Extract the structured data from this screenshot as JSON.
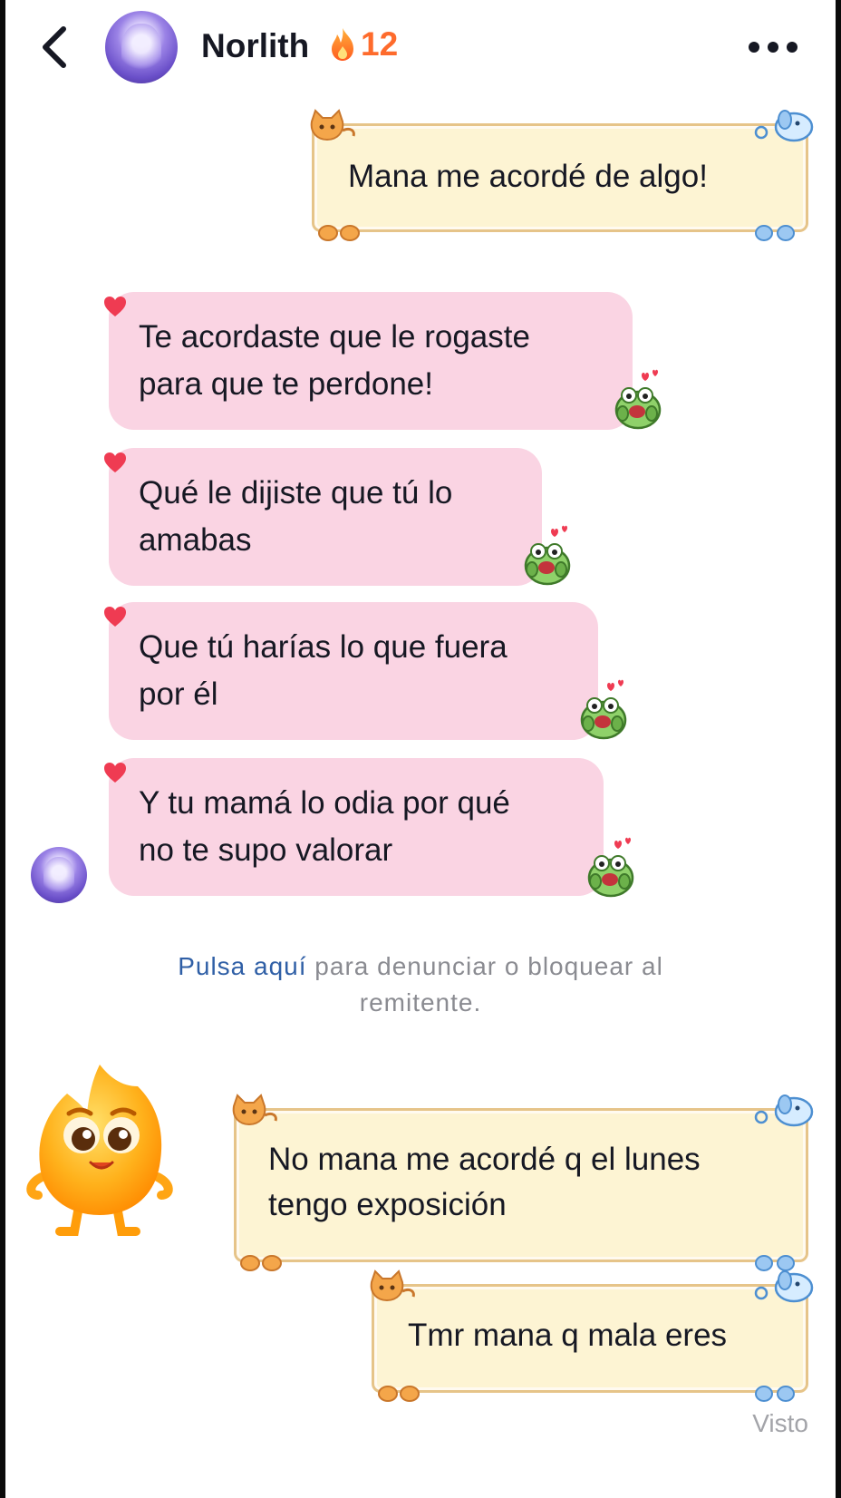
{
  "header": {
    "contact_name": "Norlith",
    "streak_count": "12",
    "icons": [
      "chevron-left-icon",
      "flame-icon",
      "more-dots-icon"
    ]
  },
  "messages": [
    {
      "side": "right",
      "style": "cream-frame",
      "text": "Mana me acordé de algo!"
    },
    {
      "side": "left",
      "style": "pink",
      "lines": [
        "Te acordaste que le rogaste",
        "para que te perdone!"
      ]
    },
    {
      "side": "left",
      "style": "pink",
      "lines": [
        "Qué le dijiste que tú lo",
        "amabas"
      ]
    },
    {
      "side": "left",
      "style": "pink",
      "lines": [
        "Que tú harías lo que fuera",
        "por él"
      ]
    },
    {
      "side": "left",
      "style": "pink",
      "lines": [
        "Y tu mamá lo odia por qué",
        "no te supo valorar"
      ]
    },
    {
      "side": "right",
      "style": "cream-frame",
      "lines": [
        "No mana me acordé q el lunes",
        "tengo exposición"
      ]
    },
    {
      "side": "right",
      "style": "cream-frame",
      "text": "Tmr mana q mala eres"
    }
  ],
  "report": {
    "link_text": "Pulsa aquí",
    "line1_rest": " para denunciar o bloquear al",
    "line2": "remitente."
  },
  "status": {
    "seen_label": "Visto"
  },
  "colors": {
    "accent_orange": "#fe6b2c",
    "link_blue": "#2f5fa6",
    "pink_bubble": "#fad4e3",
    "cream_bubble": "#fdf4d3",
    "heart_red": "#ef3b52"
  }
}
